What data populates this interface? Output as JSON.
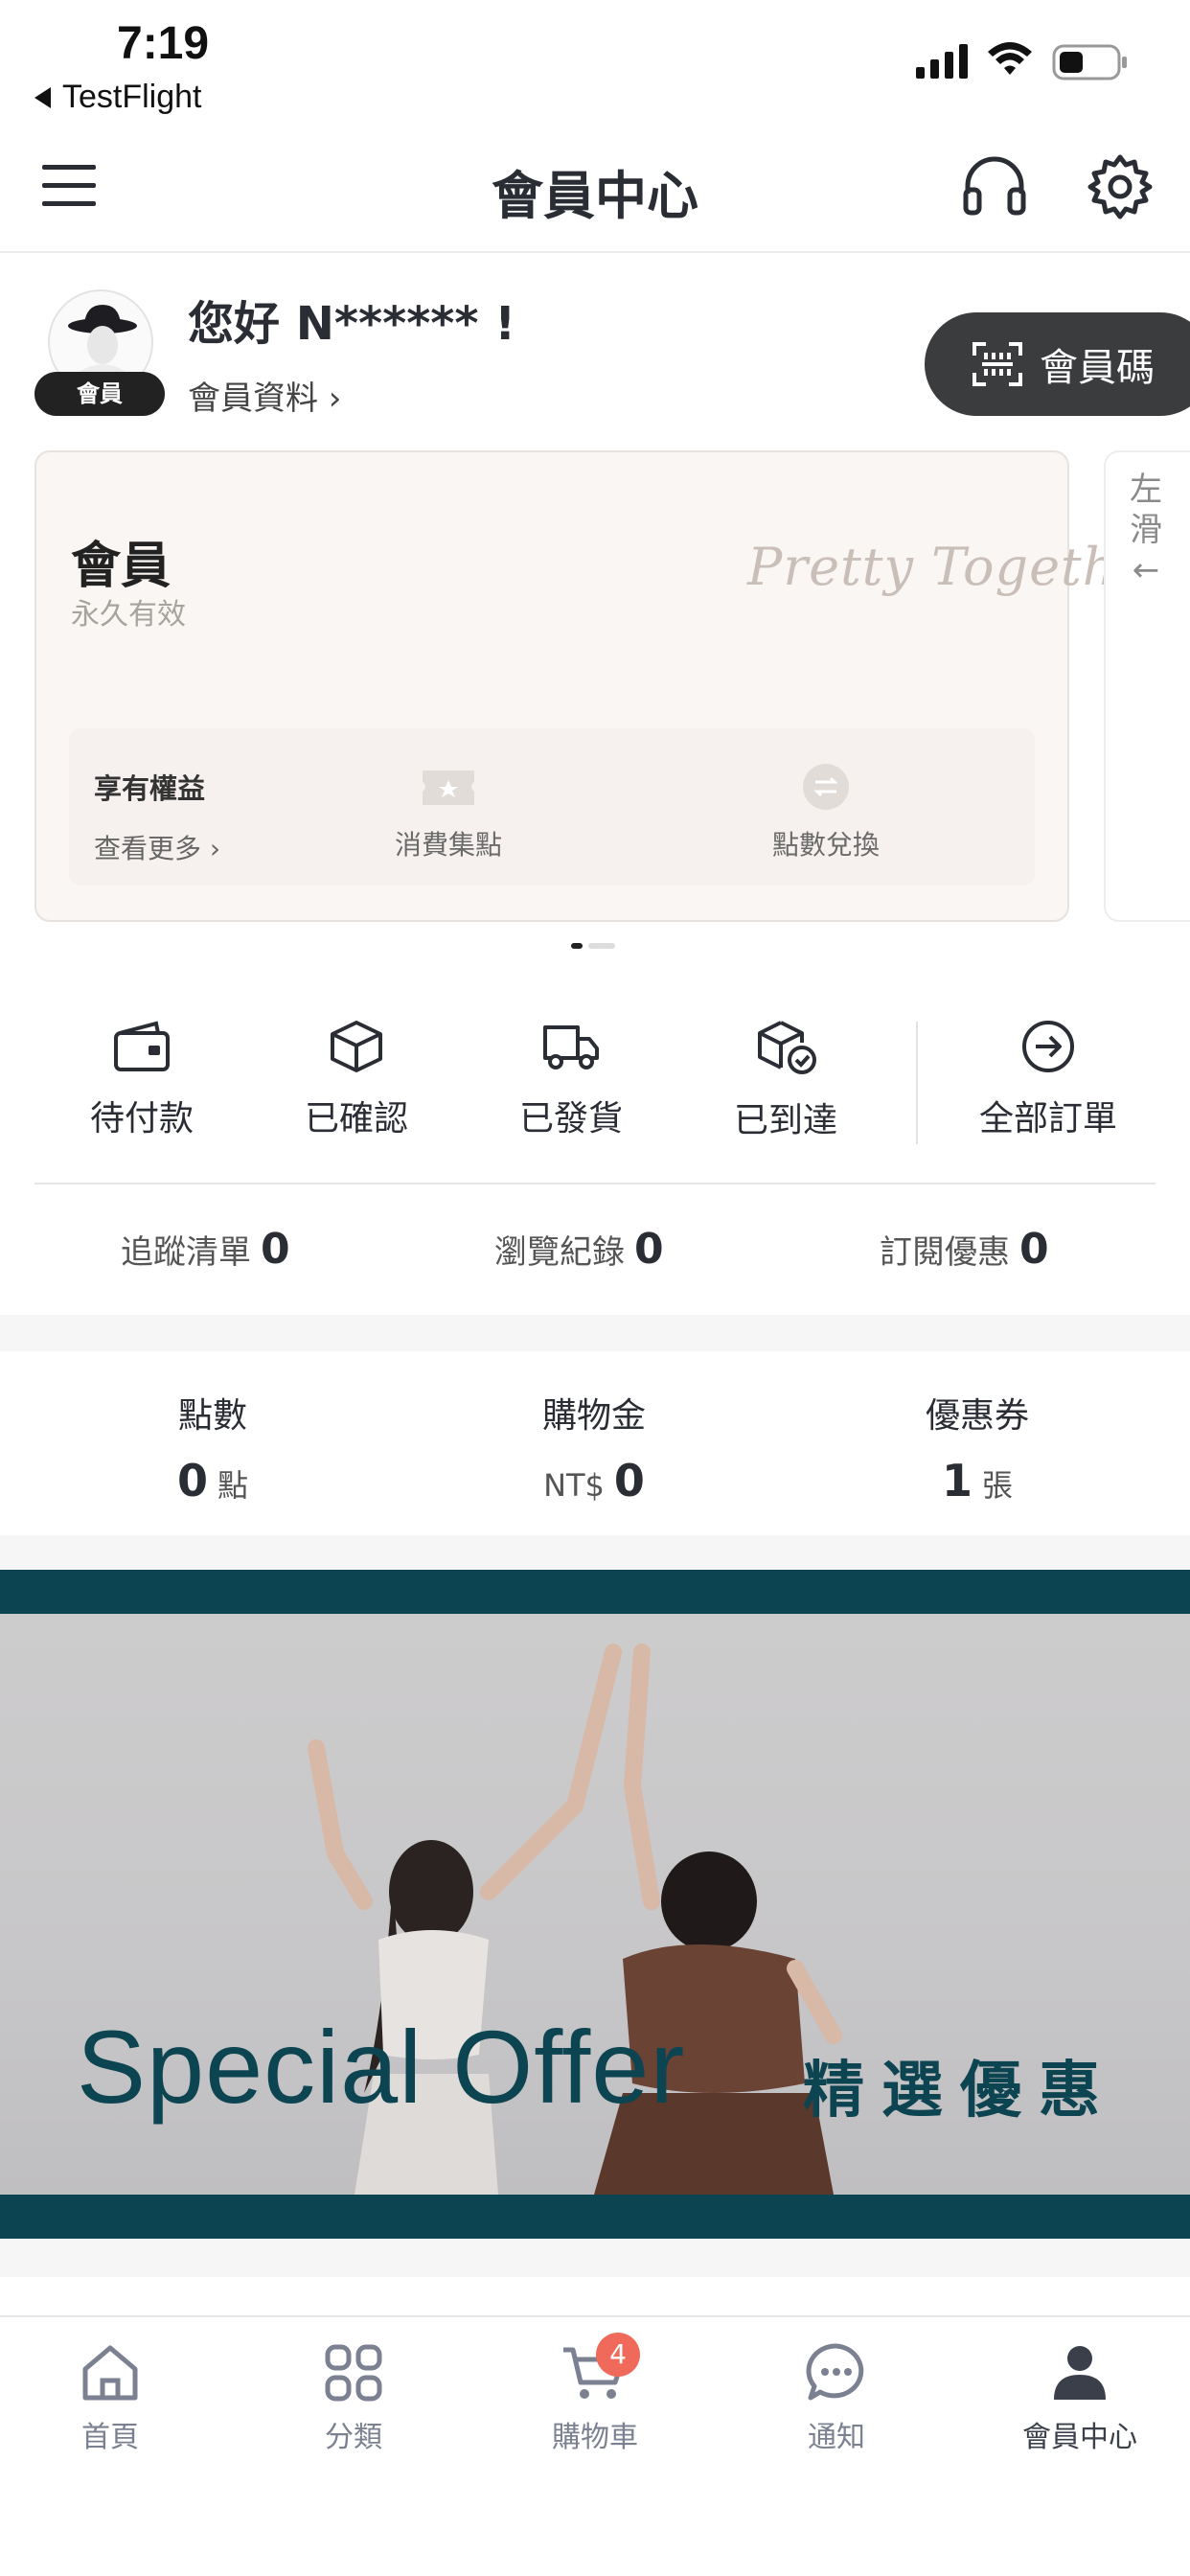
{
  "status_bar": {
    "time": "7:19",
    "back_app": "TestFlight"
  },
  "header": {
    "title": "會員中心"
  },
  "profile": {
    "greeting": "您好 N****** !",
    "badge": "會員",
    "profile_link": "會員資料 ›",
    "member_code_button": "會員碼"
  },
  "member_card": {
    "level": "會員",
    "validity": "永久有效",
    "brand_script": "Pretty Together",
    "benefits_title": "享有權益",
    "benefits_more": "查看更多 ›",
    "benefits": [
      {
        "label": "消費集點",
        "icon": "ticket-star-icon"
      },
      {
        "label": "點數兌換",
        "icon": "exchange-icon"
      }
    ],
    "peek_hint": "左滑←"
  },
  "orders": [
    {
      "label": "待付款",
      "icon": "wallet-icon"
    },
    {
      "label": "已確認",
      "icon": "box-icon"
    },
    {
      "label": "已發貨",
      "icon": "truck-icon"
    },
    {
      "label": "已到達",
      "icon": "box-check-icon"
    },
    {
      "label": "全部訂單",
      "icon": "arrow-circle-icon"
    }
  ],
  "stats": [
    {
      "label": "追蹤清單",
      "value": "0"
    },
    {
      "label": "瀏覽紀錄",
      "value": "0"
    },
    {
      "label": "訂閱優惠",
      "value": "0"
    }
  ],
  "wallet": [
    {
      "label": "點數",
      "prefix": "",
      "value": "0",
      "unit": "點"
    },
    {
      "label": "購物金",
      "prefix": "NT$",
      "value": "0",
      "unit": ""
    },
    {
      "label": "優惠券",
      "prefix": "",
      "value": "1",
      "unit": "張"
    }
  ],
  "banner": {
    "title_en": "Special Offer",
    "title_zh": "精選優惠"
  },
  "tabbar": {
    "items": [
      {
        "label": "首頁",
        "icon": "home-icon"
      },
      {
        "label": "分類",
        "icon": "grid-icon"
      },
      {
        "label": "購物車",
        "icon": "cart-icon"
      },
      {
        "label": "通知",
        "icon": "chat-icon"
      },
      {
        "label": "會員中心",
        "icon": "person-icon"
      }
    ],
    "cart_count": "4"
  },
  "colors": {
    "banner": "#0c4451",
    "badge": "#ef6a5a",
    "member_code_bg": "#3b3c3e"
  }
}
